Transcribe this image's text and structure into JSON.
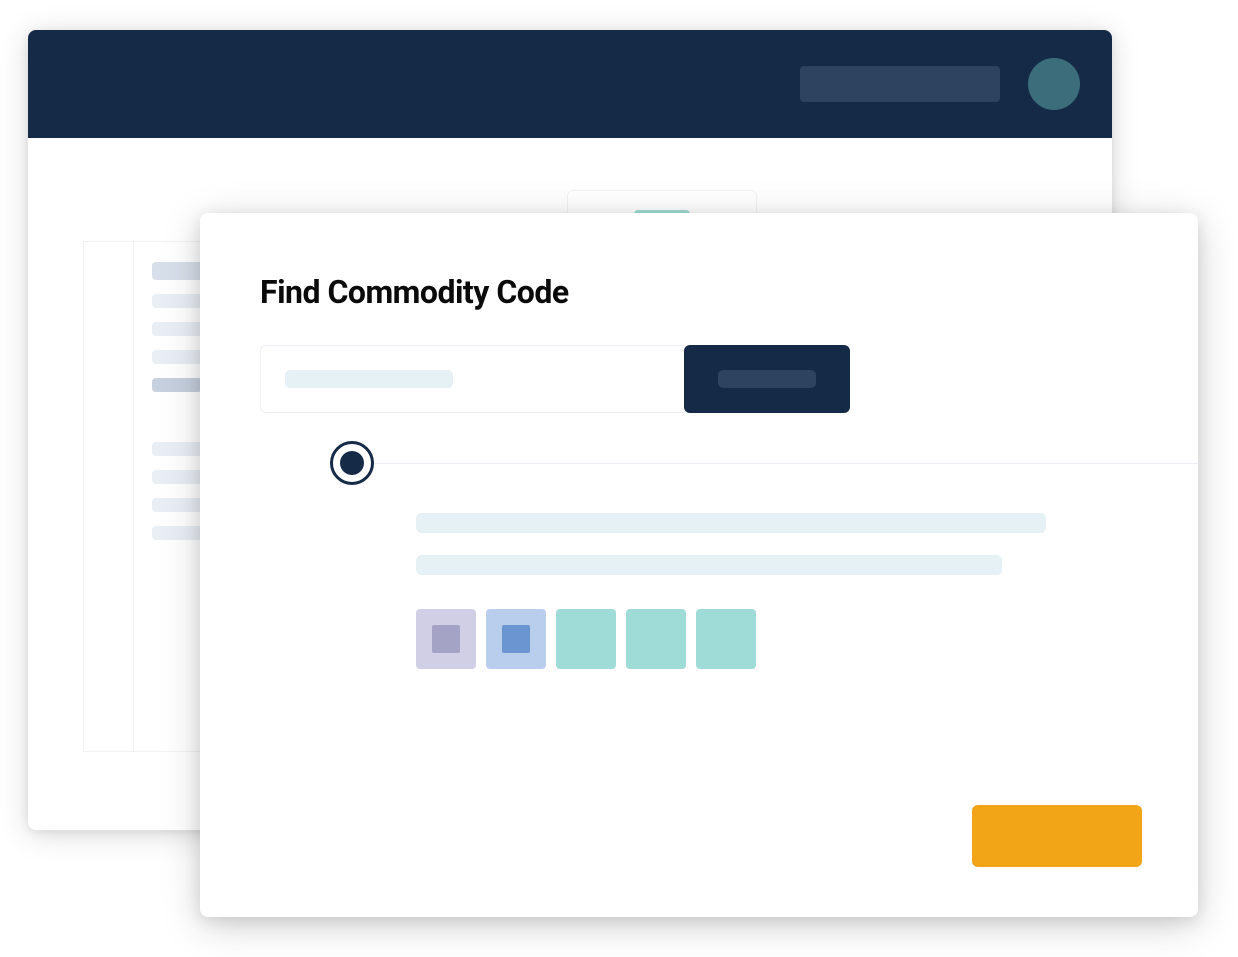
{
  "modal": {
    "title": "Find Commodity Code",
    "search": {
      "placeholder_text": "",
      "button_label": ""
    },
    "result": {
      "line1": "",
      "line2": "",
      "chips": [
        {
          "color": "purple",
          "has_inner": true
        },
        {
          "color": "blue",
          "has_inner": true
        },
        {
          "color": "teal",
          "has_inner": false
        },
        {
          "color": "teal",
          "has_inner": false
        },
        {
          "color": "teal",
          "has_inner": false
        }
      ]
    },
    "action_label": ""
  },
  "colors": {
    "navy": "#152a47",
    "navy_light": "#2d4360",
    "teal_avatar": "#3c6d7a",
    "teal_light": "#a0dcd7",
    "pale_blue": "#e5f1f4",
    "purple": "#d0cfe5",
    "blue": "#b9cded",
    "orange": "#f2a516"
  }
}
